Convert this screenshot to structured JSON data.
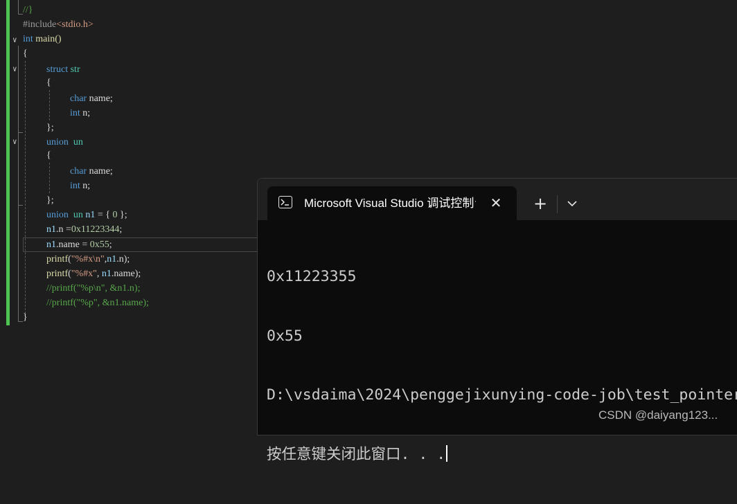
{
  "editor": {
    "code_lines": [
      [
        "//}"
      ],
      [
        "#include",
        "<stdio.h>"
      ],
      [
        "int",
        " main()"
      ],
      [
        "{"
      ],
      [
        "struct",
        " ",
        "str"
      ],
      [
        "{"
      ],
      [
        "char",
        " name;"
      ],
      [
        "int",
        " n;"
      ],
      [
        "};"
      ],
      [
        "union",
        "  ",
        "un"
      ],
      [
        "{"
      ],
      [
        "char",
        " name;"
      ],
      [
        "int",
        " n;"
      ],
      [
        "};"
      ],
      [
        "union",
        "  ",
        "un",
        " ",
        "n1",
        " = { ",
        "0",
        " };"
      ],
      [
        "n1",
        ".n =",
        "0x11223344",
        ";"
      ],
      [
        "n1",
        ".name = ",
        "0x55",
        ";"
      ],
      [
        "printf",
        "(",
        "\"%#x\\n\"",
        ",",
        "n1",
        ".n);"
      ],
      [
        "printf",
        "(",
        "\"%#x\"",
        ", ",
        "n1",
        ".name);"
      ],
      [
        "//printf(\"%p\\n\", &n1.n);"
      ],
      [
        "//printf(\"%p\", &n1.name);"
      ],
      [
        "}"
      ]
    ]
  },
  "terminal": {
    "tab_title": "Microsoft Visual Studio 调试控制台",
    "close_symbol": "✕",
    "new_tab_symbol": "+",
    "output_lines": [
      "0x11223355",
      "0x55",
      "D:\\vsdaima\\2024\\penggejixunying-code-job\\test_pointer",
      "按任意键关闭此窗口. . ."
    ]
  },
  "watermark": "CSDN @daiyang123...",
  "colors": {
    "editor_bg": "#1e1e1e",
    "terminal_bg": "#0c0c0c",
    "titlebar_bg": "#202020",
    "keyword": "#569cd6",
    "type": "#4ec9b0",
    "comment": "#57a64a",
    "change_bar": "#4ec352"
  }
}
